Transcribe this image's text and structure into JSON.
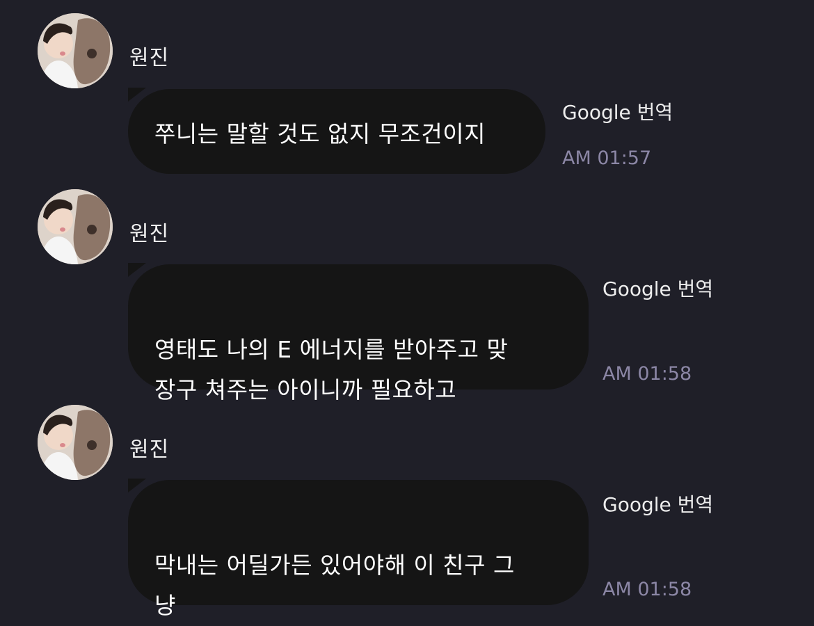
{
  "messages": [
    {
      "sender": "원진",
      "text": "쭈니는 말할 것도 없지 무조건이지",
      "translate_label": "Google 번역",
      "time": "AM 01:57"
    },
    {
      "sender": "원진",
      "text": "영태도 나의 E 에너지를 받아주고 맞\n장구 쳐주는 아이니까 필요하고",
      "translate_label": "Google 번역",
      "time": "AM 01:58"
    },
    {
      "sender": "원진",
      "text": "막내는 어딜가든 있어야해 이 친구 그\n냥",
      "translate_label": "Google 번역",
      "time": "AM 01:58"
    }
  ],
  "colors": {
    "background": "#1f1f28",
    "bubble": "#151515",
    "timestamp": "#8c87a6"
  }
}
